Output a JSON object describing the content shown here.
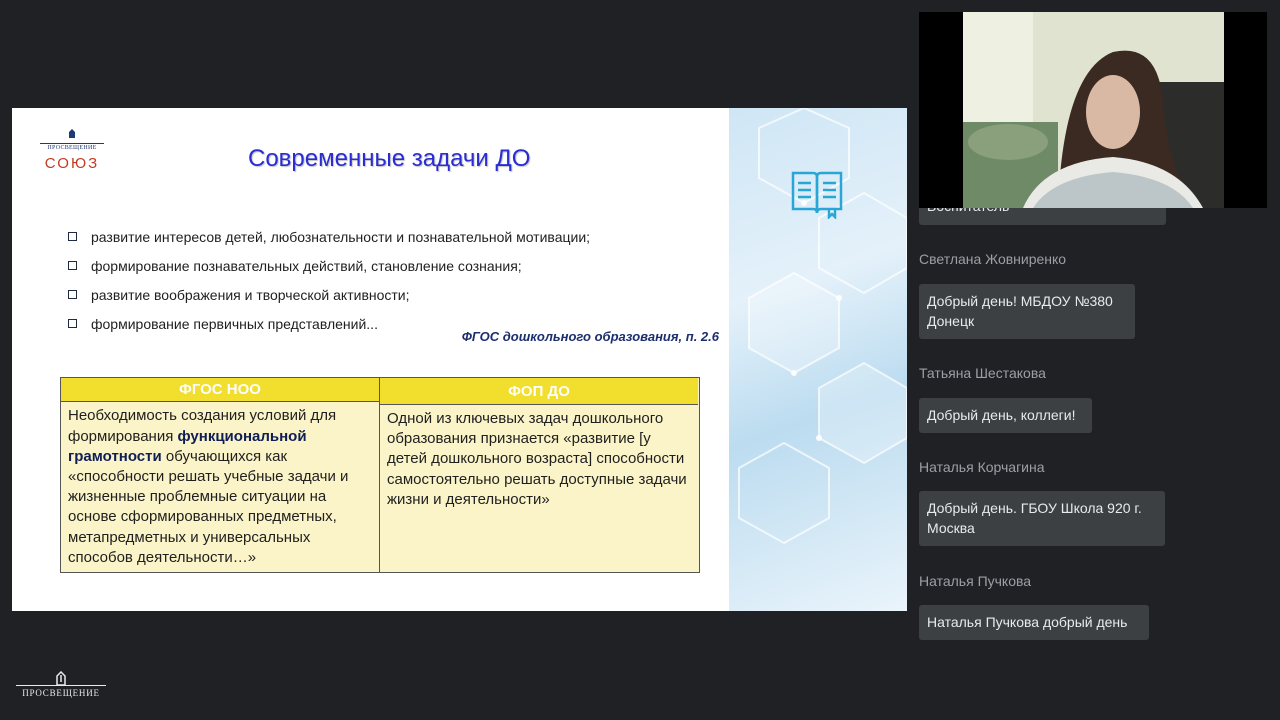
{
  "slide": {
    "brand": {
      "top": "ПРОСВЕЩЕНИЕ",
      "name": "СОЮЗ"
    },
    "title": "Современные задачи ДО",
    "bullets": [
      "развитие интересов детей, любознательности и познавательной мотивации;",
      "формирование познавательных действий, становление сознания;",
      "развитие воображения и творческой активности;",
      "формирование первичных представлений..."
    ],
    "reference": "ФГОС дошкольного образования, п. 2.6",
    "table": {
      "left_header": "ФГОС НОО",
      "right_header": "ФОП ДО",
      "left_text_1": "Необходимость создания условий для формирования ",
      "left_text_bold": "функциональной грамотности",
      "left_text_2": " обучающихся как «способности решать учебные задачи и жизненные проблемные ситуации на основе сформированных предметных, метапредметных и универсальных способов деятельности…»",
      "right_text": "Одной из ключевых задач дошкольного образования признается «развитие [у детей дошкольного возраста] способности самостоятельно решать доступные задачи жизни и деятельности»"
    },
    "icon": "book-icon"
  },
  "chat": {
    "partial_text": "Воспитатель",
    "messages": [
      {
        "author": "Светлана Жовниренко",
        "text_line1": "Добрый день! МБДОУ №380",
        "text_line2": "Донецк"
      },
      {
        "author": "Татьяна Шестакова",
        "text_line1": "Добрый день, коллеги!",
        "text_line2": ""
      },
      {
        "author": "Наталья Корчагина",
        "text_line1": "Добрый день. ГБОУ Школа 920 г.",
        "text_line2": "Москва"
      },
      {
        "author": "Наталья Пучкова",
        "text_line1": "Наталья Пучкова добрый день",
        "text_line2": ""
      }
    ]
  },
  "footer": {
    "logo_text": "ПРОСВЕЩЕНИЕ"
  },
  "colors": {
    "background": "#202124",
    "chat_bubble": "#3c4043",
    "slide_title": "#2a2cd4",
    "table_header": "#f2de2c",
    "table_body": "#fbf4c8"
  }
}
